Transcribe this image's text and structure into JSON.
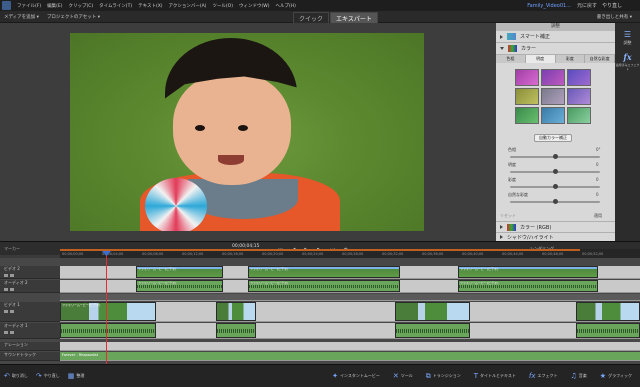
{
  "menubar": {
    "items": [
      "ファイル(F)",
      "編集(E)",
      "クリップ(C)",
      "タイムライン(T)",
      "テキスト(X)",
      "アクションバー(A)",
      "ツール(O)",
      "ウィンドウ(W)",
      "ヘルプ(H)"
    ],
    "project_title": "Family_Video01...",
    "right_items": [
      "元に戻す",
      "やり直し"
    ]
  },
  "topbar": {
    "media_dropdown": "メディアを追加 ▾",
    "project_dropdown": "プロジェクトのアセット ▾",
    "modes": [
      "クイック",
      "エキスパート"
    ],
    "active_mode": "エキスパート",
    "right_label": "書き出しと共有 ▾"
  },
  "panel": {
    "title": "調整",
    "smart_fix": "スマート補正",
    "color": "カラー",
    "tabs": [
      "色相",
      "明度",
      "彩度",
      "自然な彩度"
    ],
    "active_tab": "明度",
    "auto_fix_button": "自動カラー補正",
    "sliders": [
      {
        "label": "色相",
        "value": "0°",
        "level": 0.5
      },
      {
        "label": "明度",
        "value": "0",
        "level": 0.5
      },
      {
        "label": "彩度",
        "value": "0",
        "level": 0.5
      },
      {
        "label": "自然な彩度",
        "value": "0",
        "level": 0.5
      }
    ],
    "reset": "リセット",
    "done": "適用",
    "color_rgb": "カラー (RGB)",
    "more": "シャドウ/ハイライト"
  },
  "sidebar": {
    "items": [
      {
        "label": "調整",
        "icon": "adjust-icon"
      },
      {
        "label": "fx",
        "icon": "effects-icon",
        "caption": "適用済みエフェクト"
      }
    ]
  },
  "timeline": {
    "marker_label": "マーカー",
    "timecode": "00;00;04;15",
    "render_label": "レンダリング",
    "ruler_ticks": [
      "00;00;00;00",
      "00;00;04;00",
      "00;00;08;00",
      "00;00;12;00",
      "00;00;16;00",
      "00;00;20;00",
      "00;00;24;00",
      "00;00;28;00",
      "00;00;32;00",
      "00;00;36;00",
      "00;00;40;00",
      "00;00;44;00",
      "00;00;48;00",
      "00;00;52;00"
    ],
    "tracks": [
      {
        "name": "ビデオ 2"
      },
      {
        "name": "オーディオ 2"
      },
      {
        "name": "ビデオ 1"
      },
      {
        "name": "オーディオ 1"
      },
      {
        "name": "ナレーション"
      },
      {
        "name": "サウンドトラック"
      }
    ],
    "clip_title": "ファミリームービー[ビデオ]",
    "soundtrack_title": "Forever - Rhapsodist"
  },
  "bottombar": {
    "undo": "取り消し",
    "redo": "やり直し",
    "organizer": "整理",
    "instant_movie": "インスタントムービー",
    "tools": "ツール",
    "transitions": "トランジション",
    "titles": "タイトルとテキスト",
    "effects": "エフェクト",
    "music": "音楽",
    "graphics": "グラフィック"
  }
}
